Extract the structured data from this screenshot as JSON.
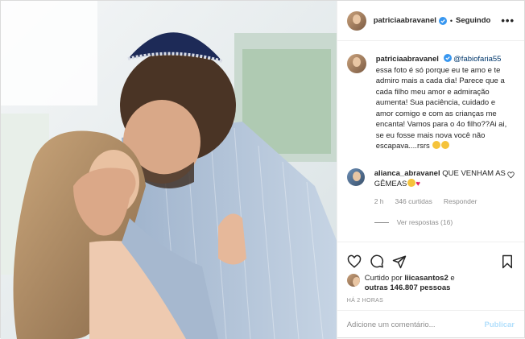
{
  "header": {
    "username": "patriciaabravanel",
    "dot": "•",
    "follow_label": "Seguindo",
    "more": "•••"
  },
  "caption": {
    "username": "patriciaabravanel",
    "mention": "@fabiofaria55",
    "text": "essa foto é só porque eu te amo e te admiro mais a cada dia! Parece que a cada filho meu amor e admiração aumenta! Sua paciência, cuidado e amor comigo e com as crianças me encanta! Vamos para o 4o filho??Ai ai, se eu fosse mais nova você não escapava....rsrs"
  },
  "reply": {
    "username": "alianca_abravanel",
    "text": "QUE VENHAM AS GÊMEAS",
    "age": "2 h",
    "likes": "346 curtidas",
    "reply_label": "Responder"
  },
  "view_replies": "Ver respostas (16)",
  "likes": {
    "prefix": "Curtido por",
    "user": "liicasantos2",
    "joiner": "e",
    "others": "outras 146.807 pessoas"
  },
  "timestamp": "HÁ 2 HORAS",
  "add_comment": {
    "placeholder": "Adicione um comentário...",
    "post_label": "Publicar"
  },
  "colors": {
    "verified": "#3897f0",
    "mention": "#00376b",
    "muted": "#8e8e8e",
    "post_disabled": "#b2dffc"
  }
}
